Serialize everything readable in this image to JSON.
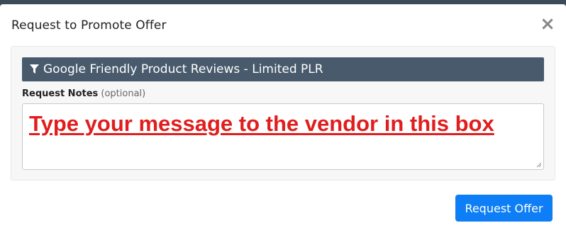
{
  "modal": {
    "title": "Request to Promote Offer",
    "close_glyph": "×"
  },
  "offer": {
    "icon": "filter-icon",
    "name": "Google Friendly Product Reviews - Limited PLR"
  },
  "notes": {
    "label": "Request Notes",
    "optional": "(optional)",
    "value": "Type your message to the vendor in this box"
  },
  "footer": {
    "request_label": "Request Offer"
  },
  "colors": {
    "offer_bar": "#485a6c",
    "primary_button": "#0d7ef6",
    "annotation_red": "#e11d1d"
  }
}
